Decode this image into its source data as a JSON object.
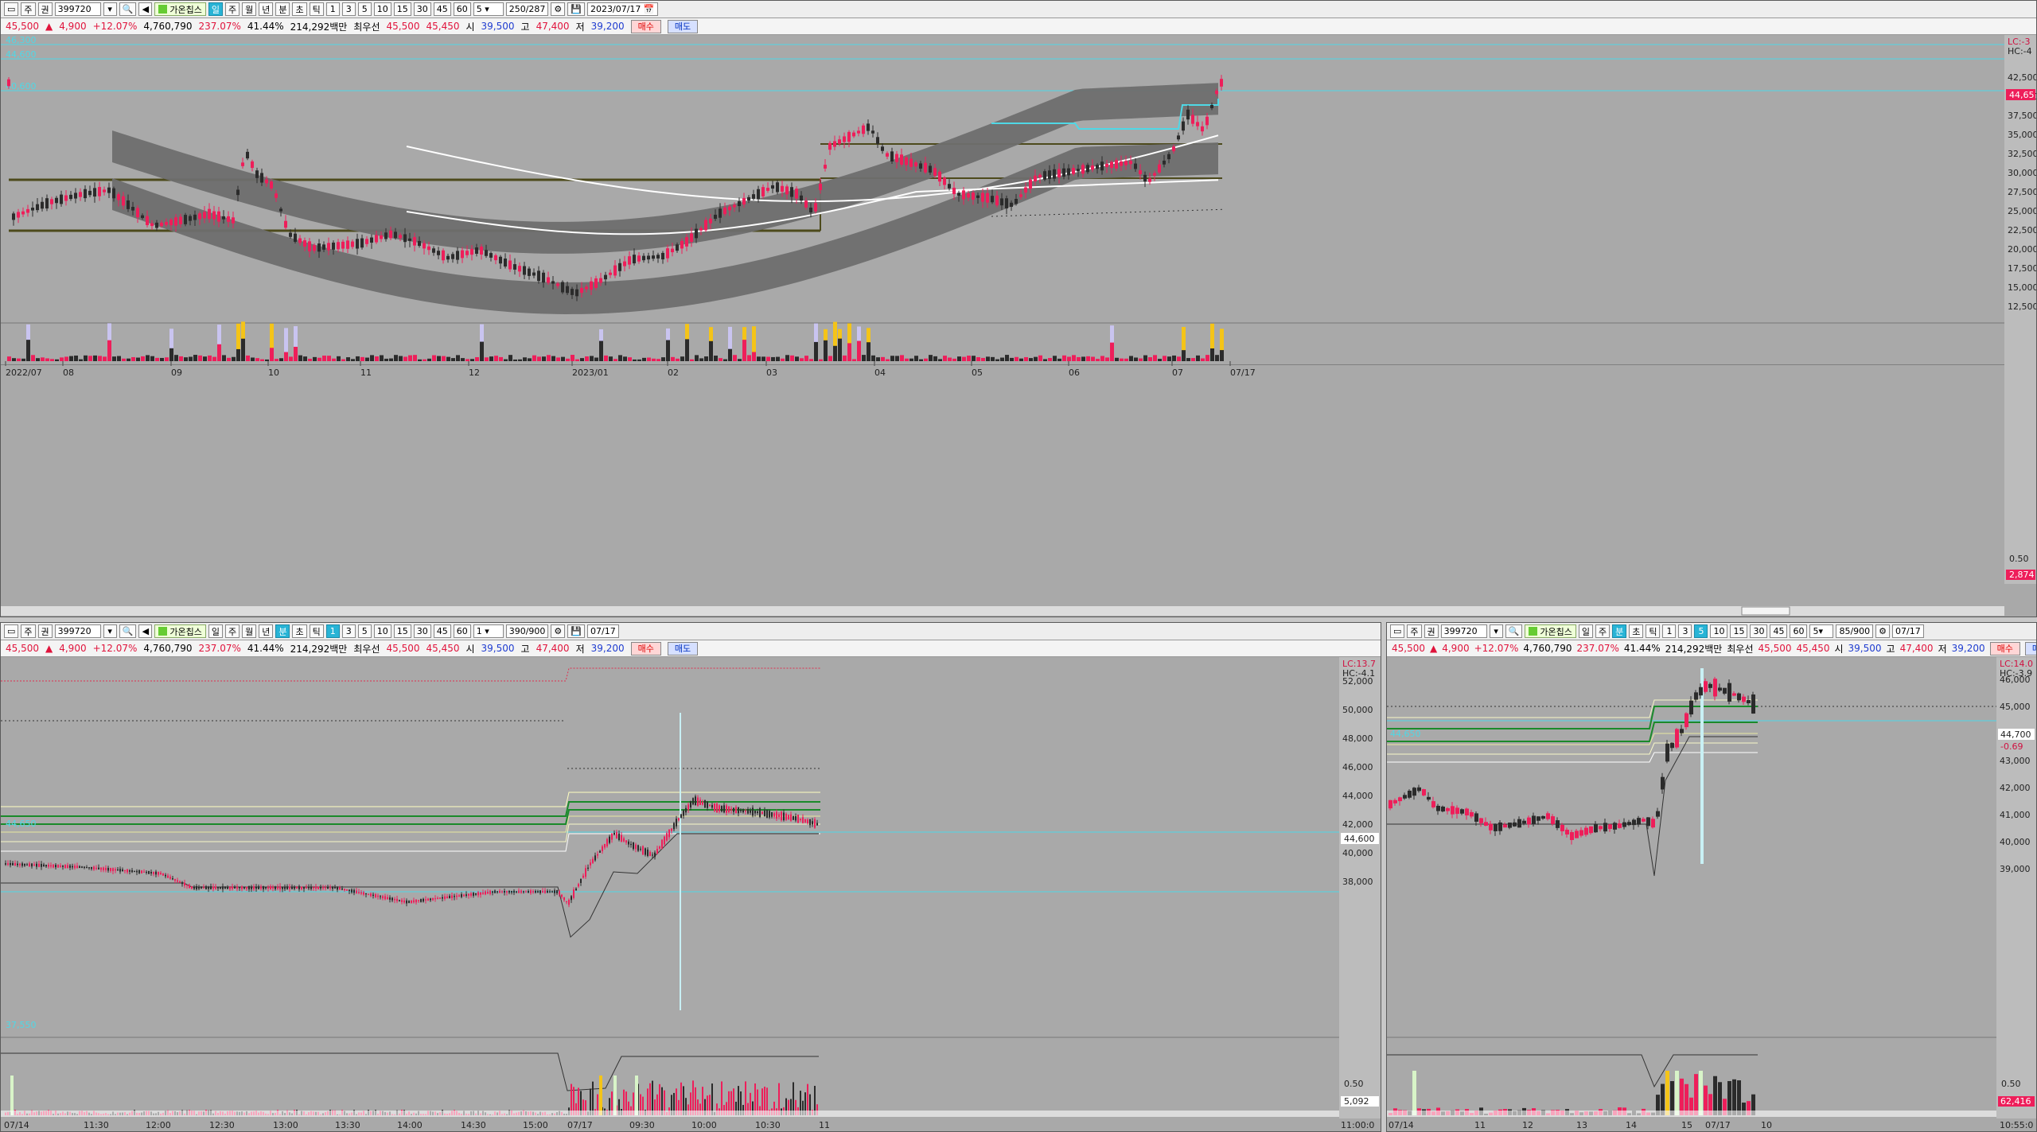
{
  "colors": {
    "up": "#ee1e5a",
    "down": "#2b2b2b",
    "cyan": "#4fd8e6",
    "band": "#6e6e6e",
    "olive": "#6f6b2a",
    "white_ma": "#ffffff",
    "panel_bg": "#a9a9a9",
    "yellow_vol": "#f4c418",
    "lavender_vol": "#c9c4f0"
  },
  "toolbar": {
    "tabs_top": [
      "주",
      "권"
    ],
    "code": "399720",
    "name": "가온칩스",
    "periods_top": [
      "일",
      "주",
      "월",
      "년",
      "분",
      "초",
      "틱"
    ],
    "minutes": [
      "1",
      "3",
      "5",
      "10",
      "15",
      "30",
      "45",
      "60"
    ],
    "count_top": "5",
    "range_top": "250/287",
    "date_top": "2023/07/17",
    "count_left": "1",
    "range_left": "390/900",
    "date_left": "07/17",
    "count_right": "5",
    "range_right": "85/900",
    "date_right": "07/17"
  },
  "quote": {
    "price": "45,500",
    "change": "4,900",
    "change_pct": "+12.07%",
    "volume": "4,760,790",
    "vol_ratio": "237.07%",
    "turnover": "41.44%",
    "amount": "214,292백만",
    "bid_label": "최우선",
    "bid1": "45,500",
    "bid2": "45,450",
    "open_label": "시",
    "open": "39,500",
    "high_label": "고",
    "high": "47,400",
    "low_label": "저",
    "low": "39,200",
    "buy_btn": "매수",
    "sell_btn": "매도"
  },
  "top_chart": {
    "yticks": [
      "42,500",
      "40,000",
      "37,500",
      "35,000",
      "32,500",
      "30,000",
      "27,500",
      "25,000",
      "22,500",
      "20,000",
      "17,500",
      "15,000",
      "12,500"
    ],
    "price_tag": "44,65",
    "hc_label": "HC:-4",
    "lc_label": "LC:-3",
    "hline_labels": [
      "46,300",
      "44,600",
      "40,600"
    ],
    "vol_tick": "0.50",
    "vol_tag": "2,874",
    "dates": [
      "2022/07",
      "08",
      "09",
      "10",
      "11",
      "12",
      "2023/01",
      "02",
      "03",
      "04",
      "05",
      "06",
      "07",
      "07/17"
    ]
  },
  "left_chart": {
    "yticks": [
      "52,000",
      "50,000",
      "48,000",
      "46,000",
      "44,000",
      "42,000",
      "40,000",
      "38,000"
    ],
    "price_tag": "44,600",
    "hc_label": "HC:-4.1",
    "lc_label": "LC:13.7",
    "cyan_labels": [
      "44,650",
      "37,550"
    ],
    "vol_tick": "0.50",
    "vol_tag": "5,092",
    "dates": [
      "07/14",
      "11:30",
      "12:00",
      "12:30",
      "13:00",
      "13:30",
      "14:00",
      "14:30",
      "15:00",
      "07/17",
      "09:30",
      "10:00",
      "10:30",
      "11",
      "11:00:0"
    ]
  },
  "right_chart": {
    "yticks": [
      "46,000",
      "45,000",
      "44,000",
      "43,000",
      "42,000",
      "41,000",
      "40,000",
      "39,000"
    ],
    "price_tag": "44,700",
    "price_tag2": "-0.69",
    "hc_label": "HC:-3.9",
    "lc_label": "LC:14.0",
    "cyan_label": "44,650",
    "vol_tick": "0.50",
    "vol_tag": "62,416",
    "dates": [
      "07/14",
      "11",
      "12",
      "13",
      "14",
      "15",
      "07/17",
      "10",
      "10:55:0"
    ]
  }
}
